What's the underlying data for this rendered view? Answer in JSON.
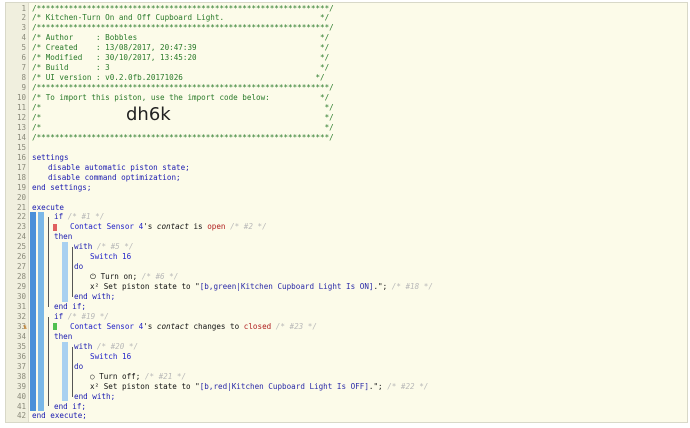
{
  "header": {
    "border": "/****************************************************************/",
    "title": "/* Kitchen-Turn On and Off Cupboard Light.                     */",
    "author": "/* Author     : Bobbles                                        */",
    "created": "/* Created    : 13/08/2017, 20:47:39                           */",
    "modified": "/* Modified   : 30/10/2017, 13:45:20                           */",
    "build": "/* Build      : 3                                              */",
    "ui_version": "/* UI version : v0.2.0fb.20171026                             */",
    "import_note": "/* To import this piston, use the import code below:           */",
    "blank": "/*                                                              */",
    "import_code": "dh6k"
  },
  "settings": {
    "open": "settings",
    "line1": "disable automatic piston state;",
    "line2": "disable command optimization;",
    "close": "end settings;"
  },
  "execute": {
    "open": "execute",
    "close": "end execute;",
    "block1": {
      "if_kw": "if",
      "if_comment": "/* #1 */",
      "device": "Contact Sensor 4",
      "possessive": "'s",
      "attribute": "contact",
      "op": "is",
      "value": "open",
      "cond_comment": "/* #2 */",
      "then_kw": "then",
      "with_kw": "with",
      "with_comment": "/* #5 */",
      "switch": "Switch 16",
      "do_kw": "do",
      "cmd1_icon": "power-icon",
      "cmd1": "Turn on;",
      "cmd1_comment": "/* #6 */",
      "cmd2_icon": "variable-icon",
      "cmd2_prefix": "Set piston state to \"",
      "cmd2_value": "[b,green|Kitchen Cupboard Light Is ON]",
      "cmd2_suffix": ".\";",
      "cmd2_comment": "/* #18 */",
      "end_with": "end with;",
      "end_if": "end if;"
    },
    "block2": {
      "if_kw": "if",
      "if_comment": "/* #19 */",
      "device": "Contact Sensor 4",
      "possessive": "'s",
      "attribute": "contact",
      "op": "changes to",
      "value": "closed",
      "cond_comment": "/* #23 */",
      "then_kw": "then",
      "with_kw": "with",
      "with_comment": "/* #20 */",
      "switch": "Switch 16",
      "do_kw": "do",
      "cmd1_icon": "power-off-icon",
      "cmd1": "Turn off;",
      "cmd1_comment": "/* #21 */",
      "cmd2_icon": "variable-icon",
      "cmd2_prefix": "Set piston state to \"",
      "cmd2_value": "[b,red|Kitchen Cupboard Light Is OFF]",
      "cmd2_suffix": ".\";",
      "cmd2_comment": "/* #22 */",
      "end_with": "end with;",
      "end_if": "end if;"
    }
  },
  "colors": {
    "background": "#fcfbe9",
    "gutter": "#f0efde",
    "execute_bar": "#4a90d9",
    "if_bar": "#7ab8e8",
    "with_bar": "#a8d0f0",
    "false_marker": "#e06060",
    "true_marker": "#50c050",
    "comment": "#2a7a2a",
    "keyword": "#1a1ab0"
  }
}
